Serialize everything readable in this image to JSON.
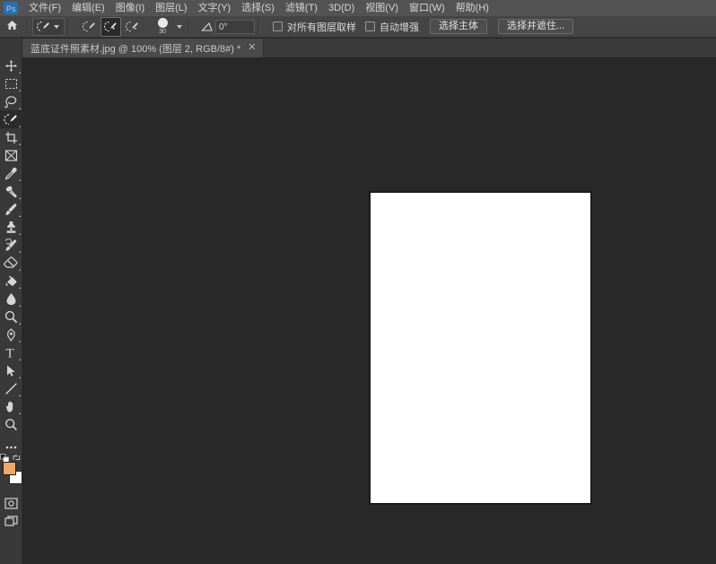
{
  "app": {
    "name": "Adobe Photoshop",
    "logo_text": "Ps",
    "accent_color": "#2a6fb0"
  },
  "menubar": {
    "items": [
      {
        "label": "文件(F)",
        "name": "menu-file"
      },
      {
        "label": "编辑(E)",
        "name": "menu-edit"
      },
      {
        "label": "图像(I)",
        "name": "menu-image"
      },
      {
        "label": "图层(L)",
        "name": "menu-layer"
      },
      {
        "label": "文字(Y)",
        "name": "menu-type"
      },
      {
        "label": "选择(S)",
        "name": "menu-select"
      },
      {
        "label": "滤镜(T)",
        "name": "menu-filter"
      },
      {
        "label": "3D(D)",
        "name": "menu-3d"
      },
      {
        "label": "视图(V)",
        "name": "menu-view"
      },
      {
        "label": "窗口(W)",
        "name": "menu-window"
      },
      {
        "label": "帮助(H)",
        "name": "menu-help"
      }
    ]
  },
  "options_bar": {
    "home_icon": "home-icon",
    "tool_preset_icon": "quick-selection-icon",
    "selection_modes": [
      {
        "name": "new-selection",
        "icon": "quick-selection-new-icon",
        "active": false
      },
      {
        "name": "add-to-selection",
        "icon": "quick-selection-add-icon",
        "active": true
      },
      {
        "name": "subtract-from-selection",
        "icon": "quick-selection-subtract-icon",
        "active": false
      }
    ],
    "brush_size": "30",
    "angle_label": "angle-icon",
    "angle_value": "0°",
    "sample_all_layers": {
      "label": "对所有图层取样",
      "checked": false
    },
    "auto_enhance": {
      "label": "自动增强",
      "checked": false
    },
    "select_subject_button": "选择主体",
    "select_and_mask_button": "选择并遮住..."
  },
  "document_tab": {
    "title": "蓝底证件照素材.jpg @ 100% (图层 2, RGB/8#) *",
    "close_icon": "close-icon"
  },
  "toolbar": {
    "tools": [
      {
        "name": "move-tool",
        "icon": "move-icon",
        "active": false,
        "has_flyout": true
      },
      {
        "name": "rectangular-marquee-tool",
        "icon": "marquee-icon",
        "active": false,
        "has_flyout": true
      },
      {
        "name": "lasso-tool",
        "icon": "lasso-icon",
        "active": false,
        "has_flyout": true
      },
      {
        "name": "quick-selection-tool",
        "icon": "quick-selection-icon",
        "active": true,
        "has_flyout": true
      },
      {
        "name": "crop-tool",
        "icon": "crop-icon",
        "active": false,
        "has_flyout": true
      },
      {
        "name": "frame-tool",
        "icon": "frame-icon",
        "active": false,
        "has_flyout": false
      },
      {
        "name": "eyedropper-tool",
        "icon": "eyedropper-icon",
        "active": false,
        "has_flyout": true
      },
      {
        "name": "spot-healing-brush-tool",
        "icon": "healing-brush-icon",
        "active": false,
        "has_flyout": true
      },
      {
        "name": "brush-tool",
        "icon": "brush-icon",
        "active": false,
        "has_flyout": true
      },
      {
        "name": "clone-stamp-tool",
        "icon": "clone-stamp-icon",
        "active": false,
        "has_flyout": true
      },
      {
        "name": "history-brush-tool",
        "icon": "history-brush-icon",
        "active": false,
        "has_flyout": true
      },
      {
        "name": "eraser-tool",
        "icon": "eraser-icon",
        "active": false,
        "has_flyout": true
      },
      {
        "name": "gradient-tool",
        "icon": "paint-bucket-icon",
        "active": false,
        "has_flyout": true
      },
      {
        "name": "blur-tool",
        "icon": "blur-drop-icon",
        "active": false,
        "has_flyout": true
      },
      {
        "name": "dodge-tool",
        "icon": "dodge-icon",
        "active": false,
        "has_flyout": true
      },
      {
        "name": "pen-tool",
        "icon": "pen-icon",
        "active": false,
        "has_flyout": true
      },
      {
        "name": "horizontal-type-tool",
        "icon": "type-icon",
        "active": false,
        "has_flyout": true
      },
      {
        "name": "path-selection-tool",
        "icon": "path-arrow-icon",
        "active": false,
        "has_flyout": true
      },
      {
        "name": "line-tool",
        "icon": "line-icon",
        "active": false,
        "has_flyout": true
      },
      {
        "name": "hand-tool",
        "icon": "hand-icon",
        "active": false,
        "has_flyout": true
      },
      {
        "name": "zoom-tool",
        "icon": "zoom-icon",
        "active": false,
        "has_flyout": false
      },
      {
        "name": "edit-toolbar-button",
        "icon": "ellipsis-icon",
        "active": false,
        "has_flyout": false
      }
    ],
    "colors": {
      "foreground": "#f0a868",
      "background": "#ffffff",
      "swap_icon": "swap-colors-icon",
      "default_icon": "default-colors-icon"
    },
    "quick_mask_icon": "quick-mask-icon",
    "screen_mode_icon": "screen-mode-icon"
  },
  "canvas": {
    "background_color": "#282828",
    "document_color": "#ffffff",
    "zoom": "100%"
  }
}
